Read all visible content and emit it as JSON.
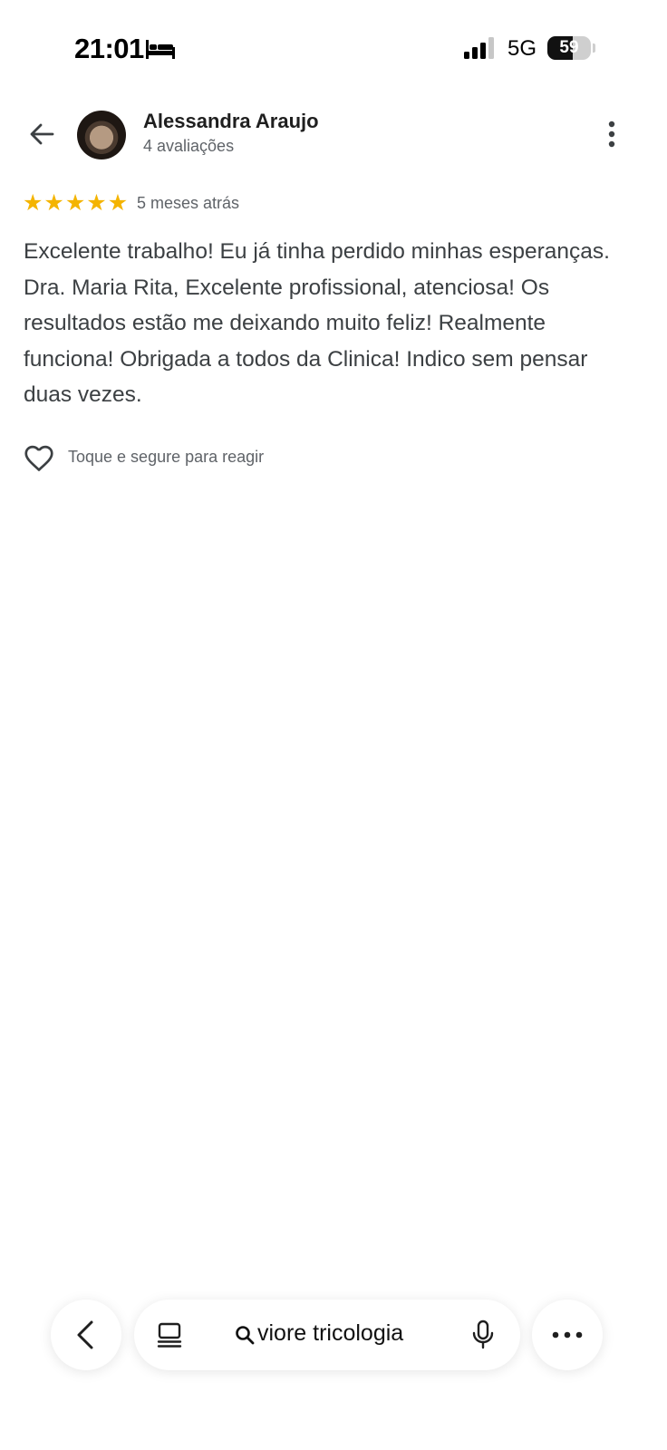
{
  "status_bar": {
    "time": "21:01",
    "network": "5G",
    "battery_level": "59",
    "battery_fraction": 0.59,
    "focus_icon": "bed-icon"
  },
  "header": {
    "back_icon": "arrow-left-icon",
    "reviewer_name": "Alessandra Araujo",
    "reviewer_reviews": "4 avaliações",
    "more_icon": "more-vertical-icon"
  },
  "review": {
    "rating": 5,
    "max_rating": 5,
    "star_color": "#f4b400",
    "age": "5 meses atrás",
    "text": "Excelente trabalho! Eu já tinha perdido minhas esperanças. Dra. Maria Rita, Excelente profissional, atenciosa! Os resultados estão me deixando muito feliz! Realmente funciona! Obrigada a todos da Clinica! Indico sem pensar duas vezes."
  },
  "reaction": {
    "icon": "heart-outline-icon",
    "hint": "Toque e segure para reagir"
  },
  "browser_bar": {
    "back_icon": "chevron-left-icon",
    "tabs_icon": "tabs-icon",
    "search_icon": "search-icon",
    "url_text": "viore tricologia",
    "mic_icon": "mic-icon",
    "more_icon": "more-horizontal-icon"
  }
}
